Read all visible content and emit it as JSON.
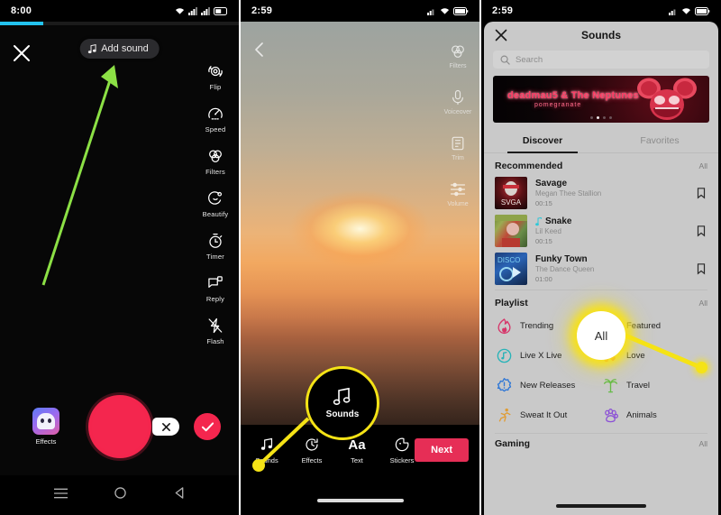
{
  "panel1": {
    "status": {
      "time": "8:00",
      "icons": [
        "wifi-icon",
        "signal-icon",
        "signal-icon",
        "battery-icon"
      ]
    },
    "progress_percent": 18,
    "close_label": "close-icon",
    "add_sound": {
      "label": "Add sound",
      "icon": "music-note-icon"
    },
    "rail": [
      {
        "label": "Flip",
        "icon": "flip-camera-icon"
      },
      {
        "label": "Speed",
        "icon": "speedometer-icon"
      },
      {
        "label": "Filters",
        "icon": "filters-circles-icon"
      },
      {
        "label": "Beautify",
        "icon": "beautify-icon"
      },
      {
        "label": "Timer",
        "icon": "timer-icon"
      },
      {
        "label": "Reply",
        "icon": "reply-icon"
      },
      {
        "label": "Flash",
        "icon": "flash-off-icon"
      }
    ],
    "effects": {
      "label": "Effects",
      "icon": "effects-thumbnail"
    },
    "record_button": "record-button",
    "delete_button": "delete-clip-button",
    "confirm_button": "confirm-check-button",
    "nav": [
      "recents-icon",
      "home-icon",
      "back-icon"
    ],
    "arrow": {
      "color": "#8ce045",
      "name": "green-pointer-arrow",
      "points_to": "Add sound"
    }
  },
  "panel2": {
    "status": {
      "time": "2:59",
      "icons": [
        "signal-icon",
        "wifi-icon",
        "battery-icon"
      ]
    },
    "back_label": "back-chevron-icon",
    "rail": [
      {
        "label": "Filters",
        "icon": "filters-circles-icon"
      },
      {
        "label": "Voiceover",
        "icon": "microphone-icon"
      },
      {
        "label": "Trim",
        "icon": "trim-icon"
      },
      {
        "label": "Volume",
        "icon": "volume-sliders-icon"
      }
    ],
    "toolbar": [
      {
        "label": "Sounds",
        "icon": "music-notes-icon"
      },
      {
        "label": "Effects",
        "icon": "effects-clock-icon"
      },
      {
        "label": "Text",
        "icon": "text-aa-icon"
      },
      {
        "label": "Stickers",
        "icon": "sticker-icon"
      }
    ],
    "next_label": "Next",
    "callout": {
      "label": "Sounds",
      "icon": "music-notes-icon",
      "ring_color": "#f5e316"
    }
  },
  "panel3": {
    "status": {
      "time": "2:59",
      "icons": [
        "signal-icon",
        "wifi-icon",
        "battery-icon"
      ]
    },
    "title": "Sounds",
    "close_label": "close-icon",
    "search": {
      "placeholder": "Search",
      "icon": "search-icon",
      "value": ""
    },
    "banner": {
      "title": "deadmau5 & The Neptunes",
      "subtitle": "pomegranate",
      "dots": 4,
      "active_dot": 2
    },
    "tabs": [
      {
        "label": "Discover",
        "active": true
      },
      {
        "label": "Favorites",
        "active": false
      }
    ],
    "recommended": {
      "title": "Recommended",
      "all_label": "All",
      "songs": [
        {
          "name": "Savage",
          "artist": "Megan Thee Stallion",
          "duration": "00:15",
          "badge": ""
        },
        {
          "name": "Snake",
          "artist": "Lil Keed",
          "duration": "00:15",
          "badge": "tiktok-note-icon"
        },
        {
          "name": "Funky Town",
          "artist": "The Dance Queen",
          "duration": "01:00",
          "badge": ""
        }
      ]
    },
    "playlist": {
      "title": "Playlist",
      "all_label": "All",
      "items": [
        {
          "label": "Trending",
          "icon": "flame-icon",
          "color": "#d6366a"
        },
        {
          "label": "Featured",
          "icon": "badge-star-icon",
          "color": "#27b3b8"
        },
        {
          "label": "Live X Live",
          "icon": "live-note-icon",
          "color": "#27b3b8"
        },
        {
          "label": "Love",
          "icon": "heart-note-icon",
          "color": "#d6366a"
        },
        {
          "label": "New Releases",
          "icon": "new-releases-icon",
          "color": "#2f77d6"
        },
        {
          "label": "Travel",
          "icon": "palm-tree-icon",
          "color": "#66bb4a"
        },
        {
          "label": "Sweat It Out",
          "icon": "runner-icon",
          "color": "#e09d35"
        },
        {
          "label": "Animals",
          "icon": "paw-icon",
          "color": "#8b4fd6"
        }
      ]
    },
    "gaming": {
      "title": "Gaming",
      "all_label": "All"
    },
    "callout": {
      "label": "All",
      "glow_color": "#f8e214"
    }
  }
}
